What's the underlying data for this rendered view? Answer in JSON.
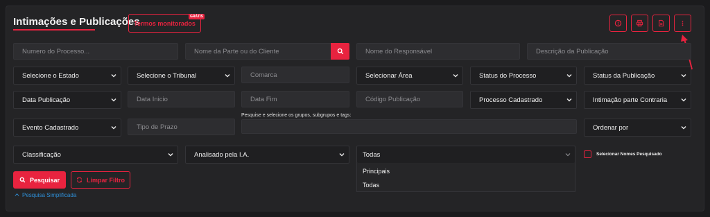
{
  "header": {
    "title": "Intimações e Publicações",
    "terms_button": "Termos monitorados",
    "terms_badge": "GRÁTIS"
  },
  "icons": [
    "help-circle-icon",
    "print-icon",
    "document-icon",
    "more-vertical-icon"
  ],
  "row1": {
    "process_number": "Numero do Processo...",
    "party_name": "Nome da Parte ou do Cliente",
    "responsible": "Nome do Responsável",
    "description": "Descrição da Publicação"
  },
  "row2": {
    "state": "Selecione o Estado",
    "court": "Selecione o Tribunal",
    "district": "Comarca",
    "area": "Selecionar Área",
    "process_status": "Status do Processo",
    "publication_status": "Status da Publicação"
  },
  "row3": {
    "pub_date": "Data Publicação",
    "start_date": "Data Inicio",
    "end_date": "Data Fim",
    "pub_code": "Código Publicação",
    "registered_process": "Processo Cadastrado",
    "opposing_party": "Intimação parte Contraria"
  },
  "row4": {
    "registered_event": "Evento Cadastrado",
    "deadline_type": "Tipo de Prazo",
    "groups_label": "Pesquise e selecione os grupos, subgrupos e tags:",
    "order_by": "Ordenar por"
  },
  "row5": {
    "classification": "Classificação",
    "ai_analyzed": "Analisado pela I.A.",
    "selected_option": "Todas",
    "options": [
      "Principais",
      "Todas"
    ],
    "checkbox_label": "Selecionar Nomes Pesquisado"
  },
  "actions": {
    "search": "Pesquisar",
    "clear": "Limpar Filtro",
    "simple_search": "Pesquisa Simplificada"
  },
  "colors": {
    "accent": "#e8233f",
    "background": "#1b1b1d",
    "panel": "#242426",
    "link": "#2f8fd6"
  }
}
